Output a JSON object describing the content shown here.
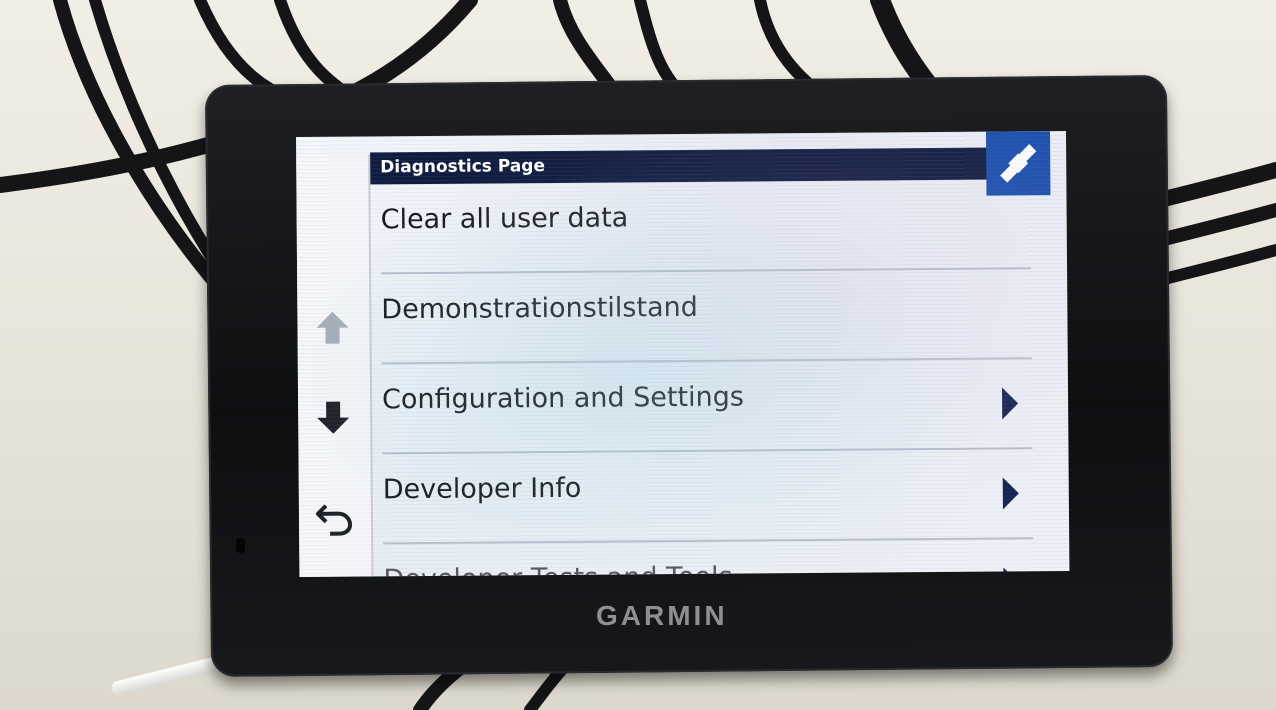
{
  "screen": {
    "title": "Diagnostics Page",
    "menu_items": [
      {
        "label": "Clear all user data",
        "has_submenu": false
      },
      {
        "label": "Demonstrationstilstand",
        "has_submenu": false
      },
      {
        "label": "Configuration and Settings",
        "has_submenu": true
      },
      {
        "label": "Developer Info",
        "has_submenu": true
      },
      {
        "label": "Developer Tests and Tools",
        "has_submenu": true
      }
    ]
  },
  "device": {
    "brand": "GARMIN"
  },
  "icons": {
    "corner": "satellite-icon",
    "up": "arrow-up-icon",
    "down": "arrow-down-icon",
    "back": "back-icon"
  },
  "colors": {
    "title_bar": "#0f1c3f",
    "corner_button": "#1a4fae",
    "chevron": "#152451",
    "bezel": "#121315"
  }
}
